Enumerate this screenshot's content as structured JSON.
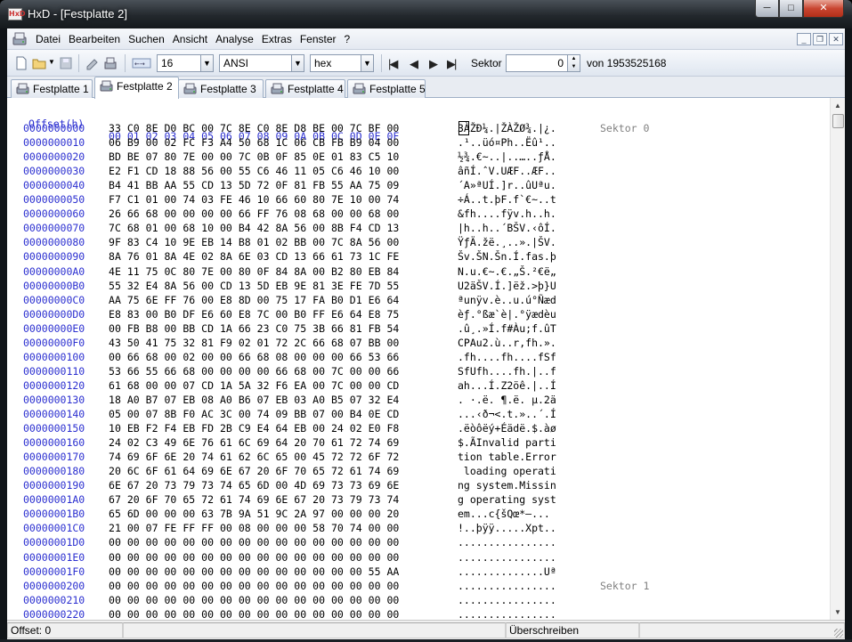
{
  "window": {
    "title": "HxD - [Festplatte 2]",
    "app_icon_text": "HxD"
  },
  "menu": [
    "Datei",
    "Bearbeiten",
    "Suchen",
    "Ansicht",
    "Analyse",
    "Extras",
    "Fenster",
    "?"
  ],
  "toolbar": {
    "bytes_per_row": "16",
    "charset": "ANSI",
    "offset_base": "hex",
    "sector_label": "Sektor",
    "sector_value": "0",
    "sector_total": "von 1953525168"
  },
  "tabs": [
    {
      "label": "Festplatte 1",
      "active": false
    },
    {
      "label": "Festplatte 2",
      "active": true
    },
    {
      "label": "Festplatte 3",
      "active": false
    },
    {
      "label": "Festplatte 4",
      "active": false
    },
    {
      "label": "Festplatte 5",
      "active": false
    }
  ],
  "hex_header": {
    "offset": "Offset(h)",
    "columns": "00 01 02 03 04 05 06 07 08 09 0A 0B 0C 0D 0E 0F"
  },
  "rows": [
    {
      "offset": "0000000000",
      "hex": "33 C0 8E D0 BC 00 7C 8E C0 8E D8 BE 00 7C BF 00",
      "ascii": "3ÀŽÐ¼.|ŽÀŽØ¾.|¿.",
      "sector": "Sektor 0"
    },
    {
      "offset": "0000000010",
      "hex": "06 B9 00 02 FC F3 A4 50 68 1C 06 CB FB B9 04 00",
      "ascii": ".¹..üó¤Ph..Ëû¹..",
      "sector": ""
    },
    {
      "offset": "0000000020",
      "hex": "BD BE 07 80 7E 00 00 7C 0B 0F 85 0E 01 83 C5 10",
      "ascii": "½¾.€~..|..…..ƒÅ.",
      "sector": ""
    },
    {
      "offset": "0000000030",
      "hex": "E2 F1 CD 18 88 56 00 55 C6 46 11 05 C6 46 10 00",
      "ascii": "âñÍ.ˆV.UÆF..ÆF..",
      "sector": ""
    },
    {
      "offset": "0000000040",
      "hex": "B4 41 BB AA 55 CD 13 5D 72 0F 81 FB 55 AA 75 09",
      "ascii": "´A»ªUÍ.]r..ûUªu.",
      "sector": ""
    },
    {
      "offset": "0000000050",
      "hex": "F7 C1 01 00 74 03 FE 46 10 66 60 80 7E 10 00 74",
      "ascii": "÷Á..t.þF.f`€~..t",
      "sector": ""
    },
    {
      "offset": "0000000060",
      "hex": "26 66 68 00 00 00 00 66 FF 76 08 68 00 00 68 00",
      "ascii": "&fh....fÿv.h..h.",
      "sector": ""
    },
    {
      "offset": "0000000070",
      "hex": "7C 68 01 00 68 10 00 B4 42 8A 56 00 8B F4 CD 13",
      "ascii": "|h..h..´BŠV.‹ôÍ.",
      "sector": ""
    },
    {
      "offset": "0000000080",
      "hex": "9F 83 C4 10 9E EB 14 B8 01 02 BB 00 7C 8A 56 00",
      "ascii": "ŸƒÄ.žë.¸..».|ŠV.",
      "sector": ""
    },
    {
      "offset": "0000000090",
      "hex": "8A 76 01 8A 4E 02 8A 6E 03 CD 13 66 61 73 1C FE",
      "ascii": "Šv.ŠN.Šn.Í.fas.þ",
      "sector": ""
    },
    {
      "offset": "00000000A0",
      "hex": "4E 11 75 0C 80 7E 00 80 0F 84 8A 00 B2 80 EB 84",
      "ascii": "N.u.€~.€.„Š.²€ë„",
      "sector": ""
    },
    {
      "offset": "00000000B0",
      "hex": "55 32 E4 8A 56 00 CD 13 5D EB 9E 81 3E FE 7D 55",
      "ascii": "U2äŠV.Í.]ëž.>þ}U",
      "sector": ""
    },
    {
      "offset": "00000000C0",
      "hex": "AA 75 6E FF 76 00 E8 8D 00 75 17 FA B0 D1 E6 64",
      "ascii": "ªunÿv.è..u.ú°Ñæd",
      "sector": ""
    },
    {
      "offset": "00000000D0",
      "hex": "E8 83 00 B0 DF E6 60 E8 7C 00 B0 FF E6 64 E8 75",
      "ascii": "èƒ.°ßæ`è|.°ÿædèu",
      "sector": ""
    },
    {
      "offset": "00000000E0",
      "hex": "00 FB B8 00 BB CD 1A 66 23 C0 75 3B 66 81 FB 54",
      "ascii": ".û¸.»Í.f#Àu;f.ûT",
      "sector": ""
    },
    {
      "offset": "00000000F0",
      "hex": "43 50 41 75 32 81 F9 02 01 72 2C 66 68 07 BB 00",
      "ascii": "CPAu2.ù..r,fh.».",
      "sector": ""
    },
    {
      "offset": "0000000100",
      "hex": "00 66 68 00 02 00 00 66 68 08 00 00 00 66 53 66",
      "ascii": ".fh....fh....fSf",
      "sector": ""
    },
    {
      "offset": "0000000110",
      "hex": "53 66 55 66 68 00 00 00 00 66 68 00 7C 00 00 66",
      "ascii": "SfUfh....fh.|..f",
      "sector": ""
    },
    {
      "offset": "0000000120",
      "hex": "61 68 00 00 07 CD 1A 5A 32 F6 EA 00 7C 00 00 CD",
      "ascii": "ah...Í.Z2öê.|..Í",
      "sector": ""
    },
    {
      "offset": "0000000130",
      "hex": "18 A0 B7 07 EB 08 A0 B6 07 EB 03 A0 B5 07 32 E4",
      "ascii": ". ·.ë. ¶.ë. µ.2ä",
      "sector": ""
    },
    {
      "offset": "0000000140",
      "hex": "05 00 07 8B F0 AC 3C 00 74 09 BB 07 00 B4 0E CD",
      "ascii": "...‹ð¬<.t.»..´.Í",
      "sector": ""
    },
    {
      "offset": "0000000150",
      "hex": "10 EB F2 F4 EB FD 2B C9 E4 64 EB 00 24 02 E0 F8",
      "ascii": ".ëòôëý+Éädë.$.àø",
      "sector": ""
    },
    {
      "offset": "0000000160",
      "hex": "24 02 C3 49 6E 76 61 6C 69 64 20 70 61 72 74 69",
      "ascii": "$.ÃInvalid parti",
      "sector": ""
    },
    {
      "offset": "0000000170",
      "hex": "74 69 6F 6E 20 74 61 62 6C 65 00 45 72 72 6F 72",
      "ascii": "tion table.Error",
      "sector": ""
    },
    {
      "offset": "0000000180",
      "hex": "20 6C 6F 61 64 69 6E 67 20 6F 70 65 72 61 74 69",
      "ascii": " loading operati",
      "sector": ""
    },
    {
      "offset": "0000000190",
      "hex": "6E 67 20 73 79 73 74 65 6D 00 4D 69 73 73 69 6E",
      "ascii": "ng system.Missin",
      "sector": ""
    },
    {
      "offset": "00000001A0",
      "hex": "67 20 6F 70 65 72 61 74 69 6E 67 20 73 79 73 74",
      "ascii": "g operating syst",
      "sector": ""
    },
    {
      "offset": "00000001B0",
      "hex": "65 6D 00 00 00 63 7B 9A 51 9C 2A 97 00 00 00 20",
      "ascii": "em...c{šQœ*—... ",
      "sector": ""
    },
    {
      "offset": "00000001C0",
      "hex": "21 00 07 FE FF FF 00 08 00 00 00 58 70 74 00 00",
      "ascii": "!..þÿÿ.....Xpt..",
      "sector": ""
    },
    {
      "offset": "00000001D0",
      "hex": "00 00 00 00 00 00 00 00 00 00 00 00 00 00 00 00",
      "ascii": "................",
      "sector": ""
    },
    {
      "offset": "00000001E0",
      "hex": "00 00 00 00 00 00 00 00 00 00 00 00 00 00 00 00",
      "ascii": "................",
      "sector": ""
    },
    {
      "offset": "00000001F0",
      "hex": "00 00 00 00 00 00 00 00 00 00 00 00 00 00 55 AA",
      "ascii": "..............Uª",
      "sector": ""
    },
    {
      "offset": "0000000200",
      "hex": "00 00 00 00 00 00 00 00 00 00 00 00 00 00 00 00",
      "ascii": "................",
      "sector": "Sektor 1"
    },
    {
      "offset": "0000000210",
      "hex": "00 00 00 00 00 00 00 00 00 00 00 00 00 00 00 00",
      "ascii": "................",
      "sector": ""
    },
    {
      "offset": "0000000220",
      "hex": "00 00 00 00 00 00 00 00 00 00 00 00 00 00 00 00",
      "ascii": "................",
      "sector": ""
    }
  ],
  "status": {
    "offset": "Offset: 0",
    "mode": "Überschreiben"
  }
}
